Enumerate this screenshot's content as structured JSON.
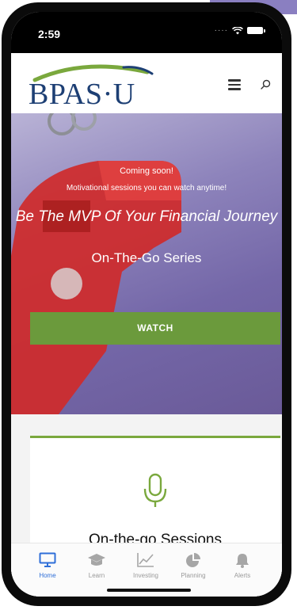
{
  "status_bar": {
    "time": "2:59"
  },
  "header": {
    "logo_text": "BPAS·U",
    "menu_icon": "hamburger-menu-icon",
    "search_icon": "search-icon"
  },
  "hero": {
    "coming_soon": "Coming soon!",
    "subtitle": "Motivational sessions you can watch anytime!",
    "headline": "Be The MVP Of Your Financial Journey",
    "series": "On-The-Go Series",
    "watch_label": "WATCH"
  },
  "card": {
    "icon": "microphone-icon",
    "title": "On-the-go Sessions"
  },
  "tabs": [
    {
      "label": "Home",
      "icon": "monitor-icon",
      "active": true
    },
    {
      "label": "Learn",
      "icon": "graduation-cap-icon",
      "active": false
    },
    {
      "label": "Investing",
      "icon": "line-chart-icon",
      "active": false
    },
    {
      "label": "Planning",
      "icon": "pie-chart-icon",
      "active": false
    },
    {
      "label": "Alerts",
      "icon": "bell-icon",
      "active": false
    }
  ],
  "colors": {
    "brand_navy": "#1d3f74",
    "brand_green": "#6b9a3c",
    "active_tab": "#2f6fd8",
    "hero_purple": "#7467a8"
  }
}
